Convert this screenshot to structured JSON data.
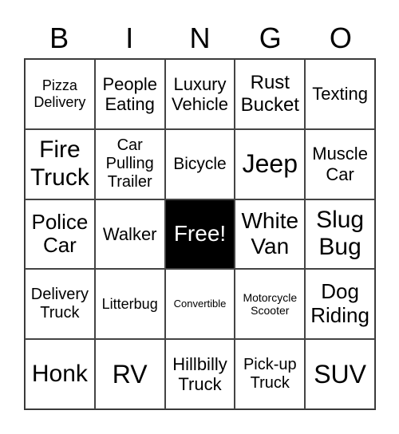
{
  "header": [
    "B",
    "I",
    "N",
    "G",
    "O"
  ],
  "cells": [
    "Pizza Delivery",
    "People Eating",
    "Luxury Vehicle",
    "Rust Bucket",
    "Texting",
    "Fire Truck",
    "Car Pulling Trailer",
    "Bicycle",
    "Jeep",
    "Muscle Car",
    "Police Car",
    "Walker",
    "Free!",
    "White Van",
    "Slug Bug",
    "Delivery Truck",
    "Litterbug",
    "Convertible",
    "Motorcycle Scooter",
    "Dog Riding",
    "Honk",
    "RV",
    "Hillbilly Truck",
    "Pick-up Truck",
    "SUV"
  ],
  "colors": {
    "free_bg": "#000000",
    "free_text": "#ffffff"
  }
}
